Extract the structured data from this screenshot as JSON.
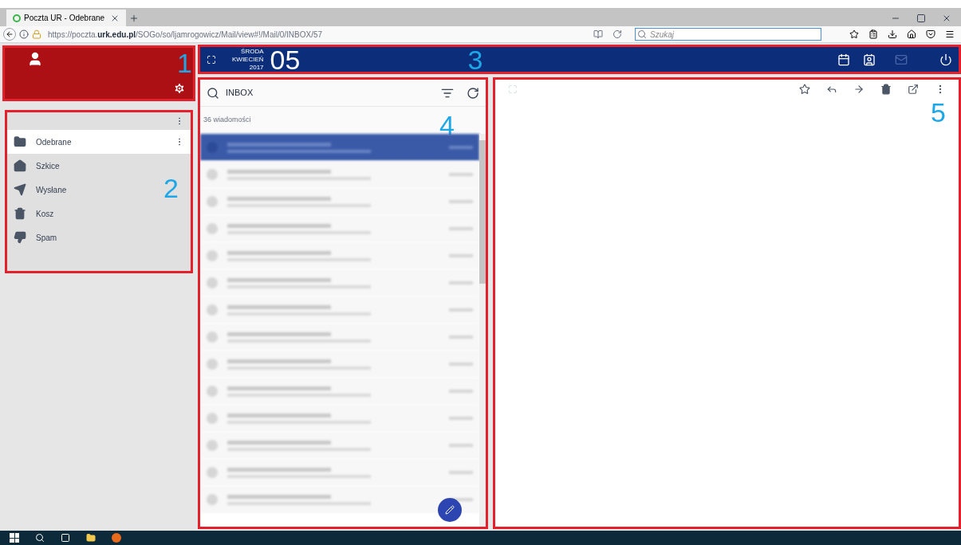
{
  "browser": {
    "tab_title": "Poczta UR - Odebrane",
    "url_prefix": "https://poczta.",
    "url_domain": "urk.edu.pl",
    "url_path": "/SOGo/so/ljamrogowicz/Mail/view#!/Mail/0/INBOX/57",
    "search_placeholder": "Szukaj"
  },
  "annotations": [
    "1",
    "2",
    "3",
    "4",
    "5"
  ],
  "date": {
    "weekday": "ŚRODA",
    "month": "KWIECIEŃ",
    "year": "2017",
    "day": "05"
  },
  "folders": [
    {
      "label": "Odebrane",
      "selected": true
    },
    {
      "label": "Szkice",
      "selected": false
    },
    {
      "label": "Wysłane",
      "selected": false
    },
    {
      "label": "Kosz",
      "selected": false
    },
    {
      "label": "Spam",
      "selected": false
    }
  ],
  "list": {
    "search_value": "INBOX",
    "count": "36 wiadomości",
    "messages": [
      {
        "selected": true
      },
      {
        "selected": false
      },
      {
        "selected": false
      },
      {
        "selected": false
      },
      {
        "selected": false
      },
      {
        "selected": false
      },
      {
        "selected": false
      },
      {
        "selected": false
      },
      {
        "selected": false
      },
      {
        "selected": false
      },
      {
        "selected": false
      },
      {
        "selected": false
      },
      {
        "selected": false
      },
      {
        "selected": false
      }
    ]
  }
}
